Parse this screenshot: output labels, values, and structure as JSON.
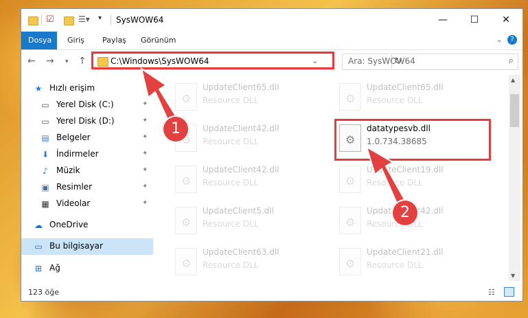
{
  "window": {
    "title": "SysWOW64",
    "controls": {
      "minimize": "—",
      "maximize": "☐",
      "close": "✕"
    }
  },
  "ribbon": {
    "tabs": [
      "Dosya",
      "Giriş",
      "Paylaş",
      "Görünüm"
    ],
    "help": "?"
  },
  "address": {
    "path": "C:\\Windows\\SysWOW64",
    "search_placeholder": "Ara: SysWOW64"
  },
  "nav": {
    "quick_access": "Hızlı erişim",
    "items": [
      {
        "label": "Yerel Disk (C:)",
        "icon": "drive-icon"
      },
      {
        "label": "Yerel Disk (D:)",
        "icon": "drive-icon"
      },
      {
        "label": "Belgeler",
        "icon": "documents-icon"
      },
      {
        "label": "İndirmeler",
        "icon": "downloads-icon"
      },
      {
        "label": "Müzik",
        "icon": "music-icon"
      },
      {
        "label": "Resimler",
        "icon": "pictures-icon"
      },
      {
        "label": "Videolar",
        "icon": "videos-icon"
      }
    ],
    "onedrive": "OneDrive",
    "this_pc": "Bu bilgisayar",
    "network": "Ağ"
  },
  "files": [
    {
      "name": "UpdateClient65.dll",
      "desc": "Resource DLL",
      "highlight": false
    },
    {
      "name": "UpdateClient65.dll",
      "desc": "Resource DLL",
      "highlight": false
    },
    {
      "name": "UpdateClient42.dll",
      "desc": "Resource DLL",
      "highlight": false
    },
    {
      "name": "datatypesvb.dll",
      "desc": "1.0.734.38685",
      "highlight": true
    },
    {
      "name": "UpdateClient42.dll",
      "desc": "Resource DLL",
      "highlight": false
    },
    {
      "name": "UpdateClient19.dll",
      "desc": "Resource DLL",
      "highlight": false
    },
    {
      "name": "UpdateClient5.dll",
      "desc": "Resource DLL",
      "highlight": false
    },
    {
      "name": "UpdateClient42.dll",
      "desc": "Resource DLL",
      "highlight": false
    },
    {
      "name": "UpdateClient63.dll",
      "desc": "Resource DLL",
      "highlight": false
    },
    {
      "name": "UpdateClient21.dll",
      "desc": "Resource DLL",
      "highlight": false
    }
  ],
  "status": {
    "count": "123 öğe"
  },
  "annotations": {
    "step1": "1",
    "step2": "2",
    "color": "#e53b3b"
  }
}
